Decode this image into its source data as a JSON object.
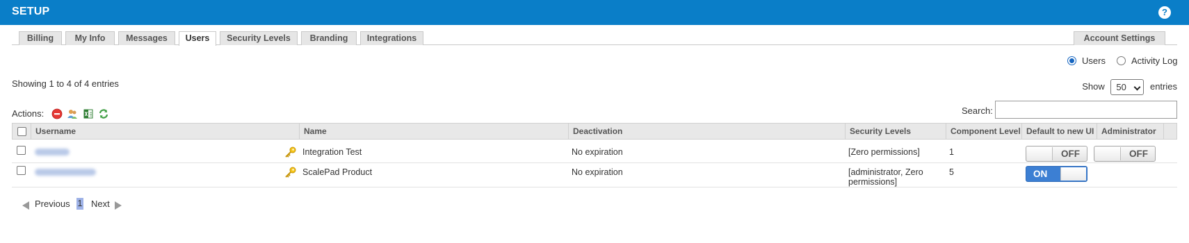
{
  "header": {
    "title": "SETUP",
    "help_glyph": "?"
  },
  "tabs": [
    "Billing",
    "My Info",
    "Messages",
    "Users",
    "Security Levels",
    "Branding",
    "Integrations"
  ],
  "active_tab": "Users",
  "account_settings_label": "Account Settings",
  "view_options": [
    {
      "label": "Users",
      "selected": true
    },
    {
      "label": "Activity Log",
      "selected": false
    }
  ],
  "info_text": "Showing 1 to 4 of 4 entries",
  "show": {
    "prefix": "Show",
    "value": "50",
    "suffix": "entries"
  },
  "actions": {
    "label": "Actions:",
    "icons": [
      "delete-icon",
      "add-users-icon",
      "export-excel-icon",
      "refresh-icon"
    ]
  },
  "search": {
    "label": "Search:",
    "value": ""
  },
  "table": {
    "columns": [
      "",
      "Username",
      "Name",
      "Deactivation",
      "Security Levels",
      "Component Level",
      "Default to new UI",
      "Administrator"
    ],
    "rows": [
      {
        "name": "Integration Test",
        "deactivation": "No expiration",
        "security_levels": "[Zero permissions]",
        "component_level": "1",
        "default_new_ui": "OFF",
        "administrator": "OFF"
      },
      {
        "name": "ScalePad Product",
        "deactivation": "No expiration",
        "security_levels_line1": "[administrator, Zero",
        "security_levels_line2": "permissions]",
        "component_level": "5",
        "default_new_ui": "ON",
        "administrator": ""
      }
    ]
  },
  "pager": {
    "previous": "Previous",
    "page": "1",
    "next": "Next"
  },
  "colors": {
    "header_bg": "#0a7ec8",
    "toggle_on": "#3c7fd3",
    "page_highlight": "#9fb3e8"
  }
}
